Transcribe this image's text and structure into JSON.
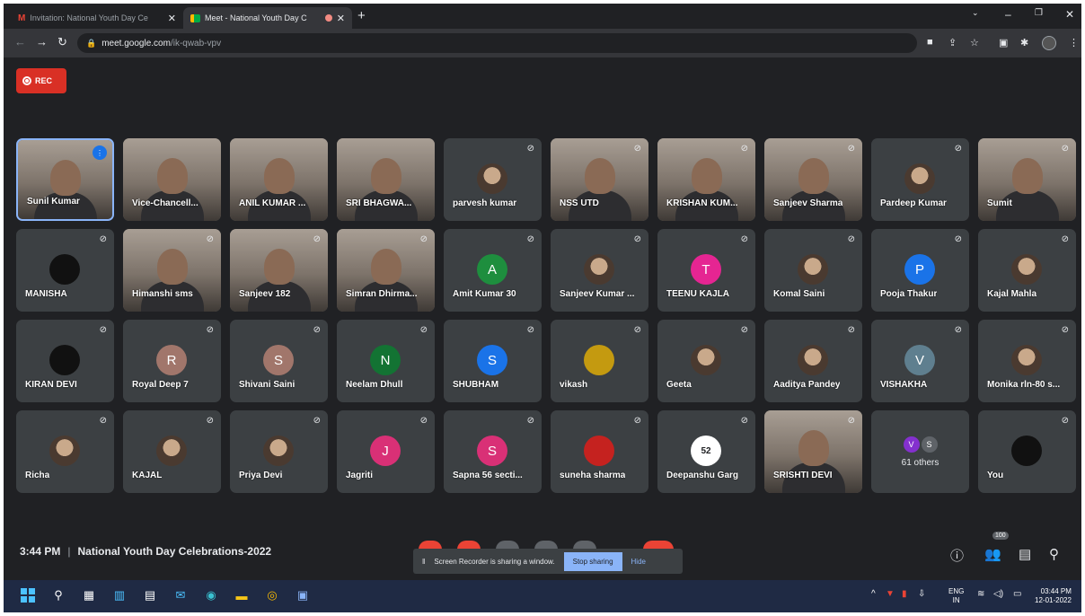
{
  "browser": {
    "tabs": [
      {
        "title": "Invitation: National Youth Day Ce",
        "active": false
      },
      {
        "title": "Meet - National Youth Day C",
        "active": true
      }
    ],
    "url_host": "meet.google.com",
    "url_path": "/ik-qwab-vpv"
  },
  "recording": {
    "label": "REC"
  },
  "participants_rows": [
    [
      {
        "name": "Sunil Kumar",
        "kind": "video",
        "speaking": true
      },
      {
        "name": "Vice-Chancell...",
        "kind": "video"
      },
      {
        "name": "ANIL KUMAR ...",
        "kind": "video"
      },
      {
        "name": "SRI BHAGWA...",
        "kind": "video"
      },
      {
        "name": "parvesh kumar",
        "kind": "photo",
        "muted": true
      },
      {
        "name": "NSS UTD",
        "kind": "video",
        "muted": true
      },
      {
        "name": "KRISHAN KUM...",
        "kind": "video",
        "muted": true
      },
      {
        "name": "Sanjeev Sharma",
        "kind": "video",
        "muted": true
      },
      {
        "name": "Pardeep Kumar",
        "kind": "photo",
        "muted": true
      },
      {
        "name": "Sumit",
        "kind": "video",
        "muted": true
      }
    ],
    [
      {
        "name": "MANISHA",
        "kind": "photo",
        "muted": true,
        "color": "#111111"
      },
      {
        "name": "Himanshi sms",
        "kind": "video",
        "muted": true
      },
      {
        "name": "Sanjeev 182",
        "kind": "video",
        "muted": true
      },
      {
        "name": "Simran Dhirma...",
        "kind": "video",
        "muted": true
      },
      {
        "name": "Amit Kumar 30",
        "kind": "initial",
        "initial": "A",
        "color": "#1e8e3e",
        "muted": true
      },
      {
        "name": "Sanjeev Kumar ...",
        "kind": "photo",
        "muted": true
      },
      {
        "name": "TEENU KAJLA",
        "kind": "initial",
        "initial": "T",
        "color": "#e52592",
        "muted": true
      },
      {
        "name": "Komal Saini",
        "kind": "photo",
        "muted": true
      },
      {
        "name": "Pooja Thakur",
        "kind": "initial",
        "initial": "P",
        "color": "#1a73e8",
        "muted": true
      },
      {
        "name": "Kajal Mahla",
        "kind": "photo",
        "muted": true
      }
    ],
    [
      {
        "name": "KIRAN DEVI",
        "kind": "photo",
        "muted": true,
        "color": "#111111"
      },
      {
        "name": "Royal Deep 7",
        "kind": "initial",
        "initial": "R",
        "color": "#a1766b",
        "muted": true
      },
      {
        "name": "Shivani Saini",
        "kind": "initial",
        "initial": "S",
        "color": "#a1766b",
        "muted": true
      },
      {
        "name": "Neelam Dhull",
        "kind": "initial",
        "initial": "N",
        "color": "#137333",
        "muted": true
      },
      {
        "name": "SHUBHAM",
        "kind": "initial",
        "initial": "S",
        "color": "#1a73e8",
        "muted": true
      },
      {
        "name": "vikash",
        "kind": "photo",
        "muted": true,
        "color": "#c49a10"
      },
      {
        "name": "Geeta",
        "kind": "photo",
        "muted": true
      },
      {
        "name": "Aaditya Pandey",
        "kind": "photo",
        "muted": true
      },
      {
        "name": "VISHAKHA",
        "kind": "initial",
        "initial": "V",
        "color": "#5f7f8f",
        "muted": true
      },
      {
        "name": "Monika rln-80 s...",
        "kind": "photo",
        "muted": true
      }
    ],
    [
      {
        "name": "Richa",
        "kind": "photo",
        "muted": true
      },
      {
        "name": "KAJAL",
        "kind": "photo",
        "muted": true
      },
      {
        "name": "Priya Devi",
        "kind": "photo",
        "muted": true
      },
      {
        "name": "Jagriti",
        "kind": "initial",
        "initial": "J",
        "color": "#d93076",
        "muted": true
      },
      {
        "name": "Sapna 56 secti...",
        "kind": "initial",
        "initial": "S",
        "color": "#d93076",
        "muted": true
      },
      {
        "name": "suneha sharma",
        "kind": "photo",
        "muted": true,
        "color": "#c5221f"
      },
      {
        "name": "Deepanshu Garg",
        "kind": "initial",
        "initial": "52",
        "color": "#ffffff",
        "muted": true
      },
      {
        "name": "SRISHTI DEVI",
        "kind": "video",
        "muted": true
      },
      {
        "name": "",
        "kind": "others",
        "others_label": "61 others",
        "others_initials": [
          "V",
          "S"
        ]
      },
      {
        "name": "You",
        "kind": "photo",
        "muted": true,
        "color": "#111111"
      }
    ]
  ],
  "footer": {
    "time": "3:44 PM",
    "separator": "|",
    "meeting_title": "National Youth Day Celebrations-2022",
    "participant_badge": "100"
  },
  "share_bar": {
    "message": "Screen Recorder is sharing a window.",
    "stop_label": "Stop sharing",
    "hide_label": "Hide"
  },
  "taskbar": {
    "lang_line1": "ENG",
    "lang_line2": "IN",
    "clock_time": "03:44 PM",
    "clock_date": "12-01-2022"
  }
}
